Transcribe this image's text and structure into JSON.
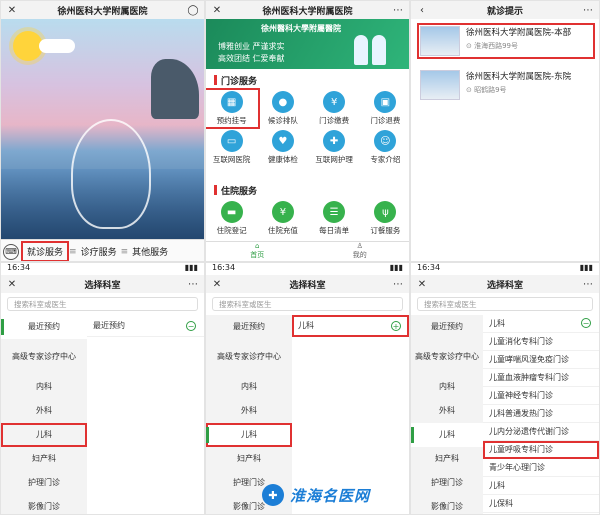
{
  "panel1": {
    "title": "徐州医科大学附属医院",
    "bottom_bar": [
      "就诊服务",
      "诊疗服务",
      "其他服务"
    ]
  },
  "panel2": {
    "title": "徐州医科大学附属医院",
    "banner_logo": "徐州醫科大學附屬醫院",
    "banner_line1": "博雅创业 严谨求实",
    "banner_line2": "高效团结 仁爱奉献",
    "section1": "门诊服务",
    "outpatient": [
      "预约挂号",
      "候诊排队",
      "门诊缴费",
      "门诊退费",
      "互联网医院",
      "健康体检",
      "互联网护理",
      "专家介绍"
    ],
    "section2": "住院服务",
    "inpatient": [
      "住院登记",
      "住院充值",
      "每日清单",
      "订餐服务"
    ],
    "tab_home": "首页",
    "tab_me": "我的"
  },
  "panel3": {
    "title": "就诊提示",
    "cards": [
      {
        "name": "徐州医科大学附属医院-本部",
        "addr": "淮海西路99号"
      },
      {
        "name": "徐州医科大学附属医院-东院",
        "addr": "昭鹤路9号"
      }
    ]
  },
  "panel4": {
    "time": "16:34",
    "title": "选择科室",
    "search_placeholder": "搜索科室或医生",
    "left": [
      "最近预约",
      "高级专家诊疗中心",
      "内科",
      "外科",
      "儿科",
      "妇产科",
      "护理门诊",
      "影像门诊"
    ],
    "right": [
      "最近预约"
    ]
  },
  "panel5": {
    "time": "16:34",
    "title": "选择科室",
    "search_placeholder": "搜索科室或医生",
    "left": [
      "最近预约",
      "高级专家诊疗中心",
      "内科",
      "外科",
      "儿科",
      "妇产科",
      "护理门诊",
      "影像门诊"
    ],
    "right": [
      "儿科"
    ]
  },
  "panel6": {
    "time": "16:34",
    "title": "选择科室",
    "search_placeholder": "搜索科室或医生",
    "left": [
      "最近预约",
      "高级专家诊疗中心",
      "内科",
      "外科",
      "儿科",
      "妇产科",
      "护理门诊",
      "影像门诊"
    ],
    "right": [
      "儿科",
      "儿童消化专科门诊",
      "儿童哮喘风湿免疫门诊",
      "儿童血液肿瘤专科门诊",
      "儿童神经专科门诊",
      "儿科普通发热门诊",
      "儿内分泌遗传代谢门诊",
      "儿童呼吸专科门诊",
      "青少年心理门诊",
      "儿科",
      "儿保科"
    ]
  },
  "watermark": {
    "text": "淮海名医网"
  }
}
